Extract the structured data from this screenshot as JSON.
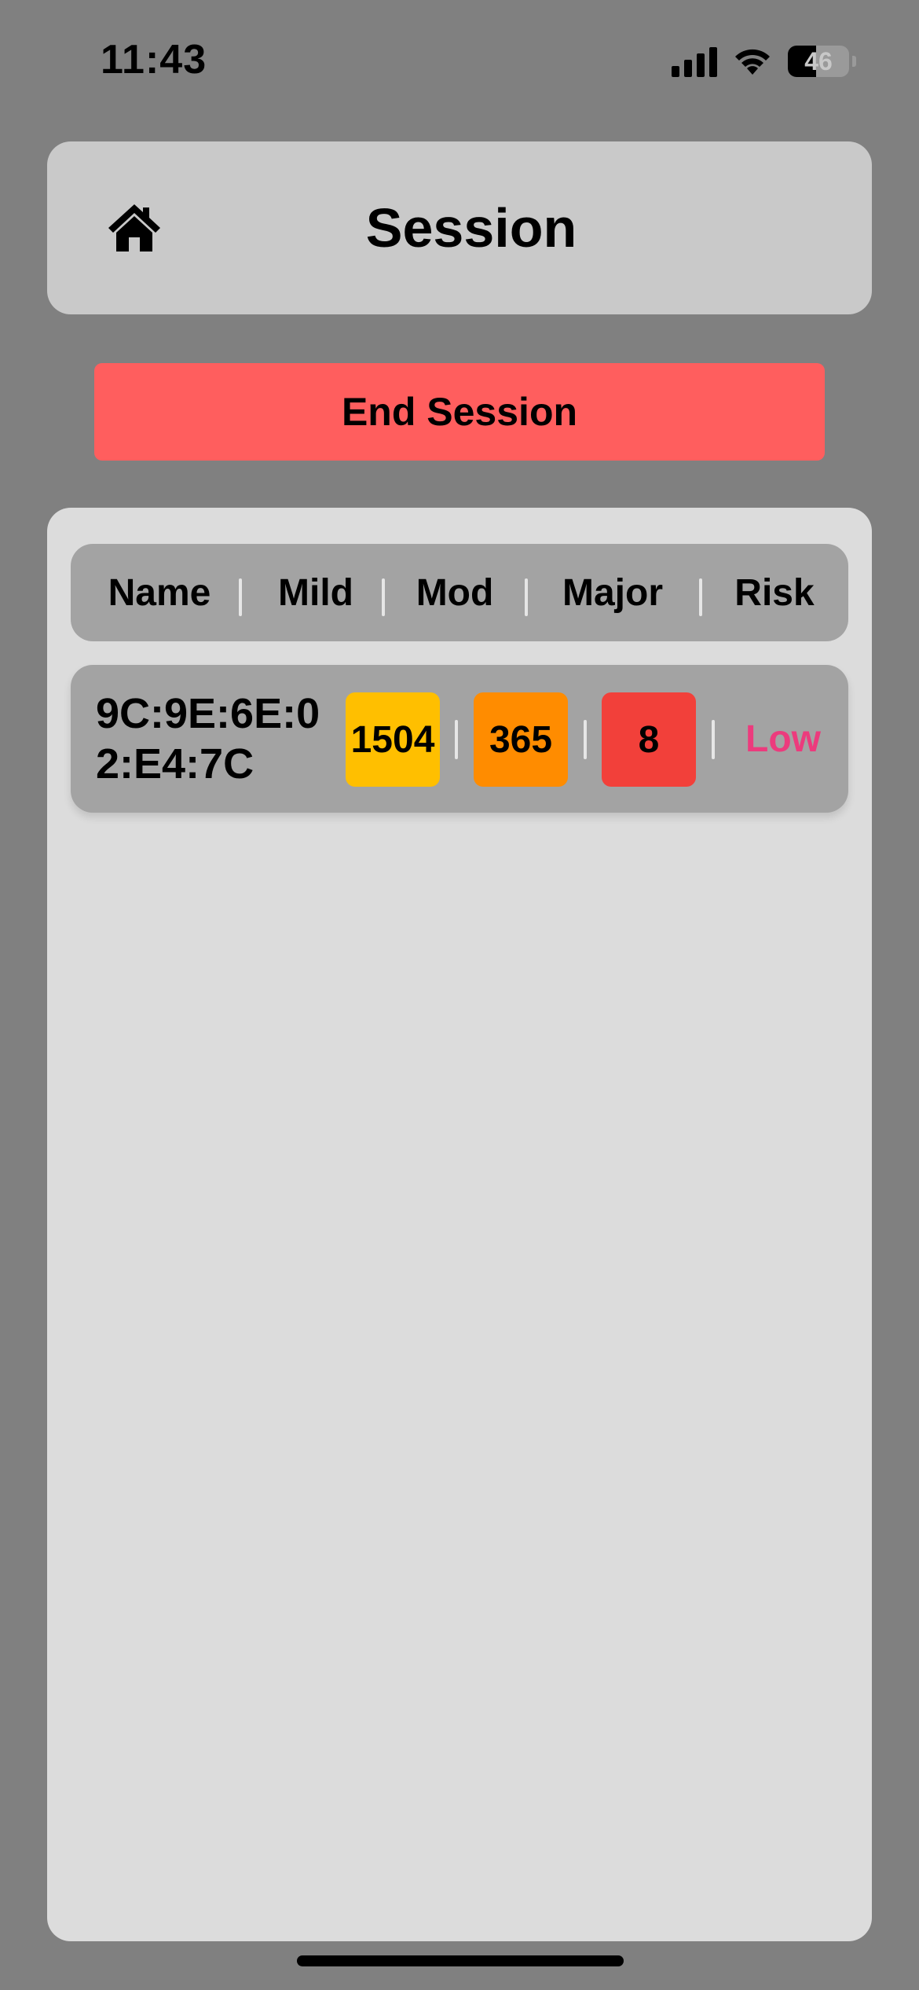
{
  "status_bar": {
    "time": "11:43",
    "battery_percent": "46",
    "battery_level": 0.46,
    "icons": [
      "signal-icon",
      "wifi-icon",
      "battery-icon"
    ]
  },
  "header": {
    "title": "Session",
    "home_icon": "home-icon"
  },
  "actions": {
    "end_session_label": "End Session"
  },
  "table": {
    "columns": [
      "Name",
      "Mild",
      "Mod",
      "Major",
      "Risk"
    ],
    "rows": [
      {
        "name": "9C:9E:6E:02:E4:7C",
        "mild": "1504",
        "mod": "365",
        "major": "8",
        "risk": "Low"
      }
    ]
  },
  "colors": {
    "background": "#808080",
    "header_card": "#c9c9c9",
    "end_button": "#ff5e5e",
    "panel": "#dcdcdc",
    "row": "#a3a3a3",
    "mild_badge": "#ffbf00",
    "mod_badge": "#ff8c00",
    "major_badge": "#f2403a",
    "risk_low_text": "#ec3b7d"
  }
}
